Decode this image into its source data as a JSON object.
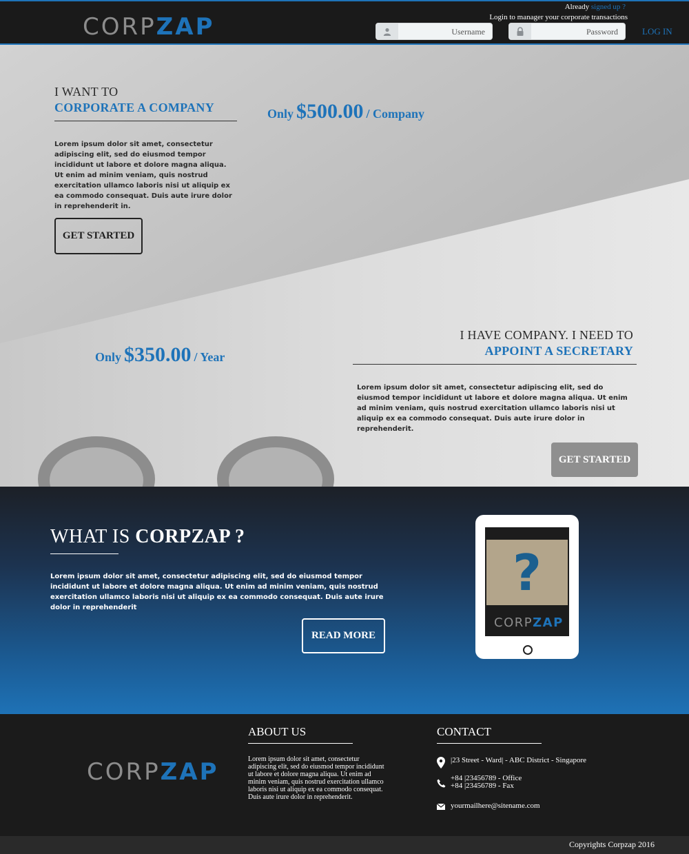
{
  "brand": {
    "logo_light": "CORP",
    "logo_bold": "ZAP"
  },
  "header": {
    "already": "Already",
    "signed_up_link": "signed up ?",
    "login_hint": "Login to manager your corporate transactions",
    "username_placeholder": "Username",
    "password_placeholder": "Password",
    "login_label": "LOG IN"
  },
  "hero": {
    "corporate": {
      "kicker": "I WANT TO",
      "headline": "CORPORATE A COMPANY",
      "text": "Lorem ipsum dolor sit amet, consectetur adipiscing elit, sed do eiusmod tempor incididunt ut labore et dolore magna aliqua. Ut enim ad minim veniam, quis nostrud exercitation ullamco laboris nisi ut aliquip ex ea commodo consequat. Duis aute irure dolor in reprehenderit in.",
      "button": "GET STARTED",
      "price_prefix": "Only",
      "price": "$500.00",
      "price_suffix": "/ Company"
    },
    "secretary": {
      "kicker": "I HAVE COMPANY. I NEED TO",
      "headline": "APPOINT A SECRETARY",
      "text": "Lorem ipsum dolor sit amet, consectetur adipiscing elit, sed do eiusmod tempor incididunt ut labore et dolore magna aliqua. Ut enim ad minim veniam, quis nostrud exercitation ullamco laboris nisi ut aliquip ex ea commodo consequat. Duis aute irure dolor in reprehenderit.",
      "button": "GET STARTED",
      "price_prefix": "Only",
      "price": "$350.00",
      "price_suffix": "/ Year"
    }
  },
  "whatis": {
    "title_prefix": "WHAT IS",
    "title_bold": "CORPZAP ?",
    "text": "Lorem ipsum dolor sit amet, consectetur adipiscing elit, sed do eiusmod tempor incididunt ut labore et dolore magna aliqua. Ut enim ad minim veniam, quis nostrud exercitation ullamco laboris nisi ut aliquip ex ea commodo consequat. Duis aute irure dolor in reprehenderit",
    "button": "READ MORE",
    "tablet_glyph": "?"
  },
  "footer": {
    "about_title": "ABOUT US",
    "about_text": "Lorem ipsum dolor sit amet, consectetur adipiscing elit, sed do eiusmod tempor incididunt ut labore et dolore magna aliqua. Ut enim ad minim veniam, quis nostrud exercitation ullamco laboris nisi ut aliquip ex ea commodo consequat. Duis aute irure dolor in reprehenderit.",
    "contact_title": "CONTACT",
    "address": "|23 Street - Ward| - ABC District - Singapore",
    "phone_office": "+84 |23456789 - Office",
    "phone_fax": "+84 |23456789 - Fax",
    "email": "yourmailhere@sitename.com",
    "copyright": "Copyrights Corpzap 2016"
  },
  "colors": {
    "accent": "#1e73b9",
    "dark": "#1b1b1b",
    "button_gray": "#8f8f8f"
  },
  "icons": [
    "user-icon",
    "lock-icon",
    "map-pin-icon",
    "phone-icon",
    "mail-icon"
  ]
}
